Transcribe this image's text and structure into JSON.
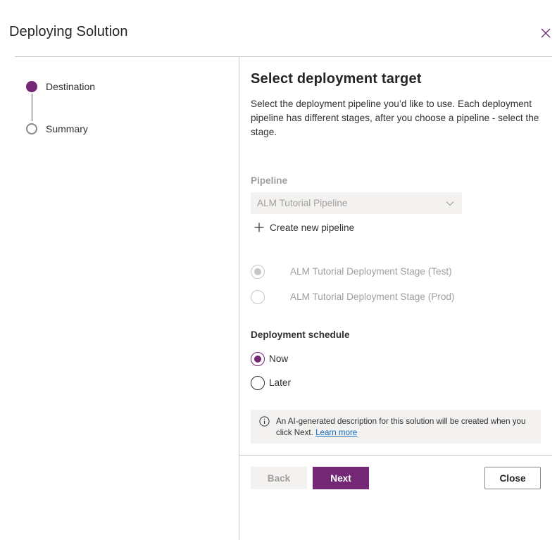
{
  "dialog": {
    "title": "Deploying Solution",
    "close_icon": "close-icon"
  },
  "stepper": {
    "steps": [
      {
        "label": "Destination",
        "state": "active"
      },
      {
        "label": "Summary",
        "state": "inactive"
      }
    ]
  },
  "main": {
    "title": "Select deployment target",
    "description": "Select the deployment pipeline you’d like to use. Each deployment pipeline has different stages, after you choose a pipeline - select the stage.",
    "pipeline": {
      "label": "Pipeline",
      "value": "ALM Tutorial Pipeline",
      "create_label": "Create new pipeline"
    },
    "stages": [
      {
        "label": "ALM Tutorial Deployment Stage (Test)",
        "checked": true,
        "disabled": true
      },
      {
        "label": "ALM Tutorial Deployment Stage (Prod)",
        "checked": false,
        "disabled": true
      }
    ],
    "schedule": {
      "label": "Deployment schedule",
      "options": [
        {
          "label": "Now",
          "checked": true
        },
        {
          "label": "Later",
          "checked": false
        }
      ]
    },
    "info": {
      "text": "An AI-generated description for this solution will be created when you click Next.",
      "link": "Learn more"
    }
  },
  "footer": {
    "back_label": "Back",
    "next_label": "Next",
    "close_label": "Close"
  },
  "colors": {
    "accent": "#742774",
    "disabled_text": "#a19f9d",
    "divider": "#c8c6c4"
  }
}
